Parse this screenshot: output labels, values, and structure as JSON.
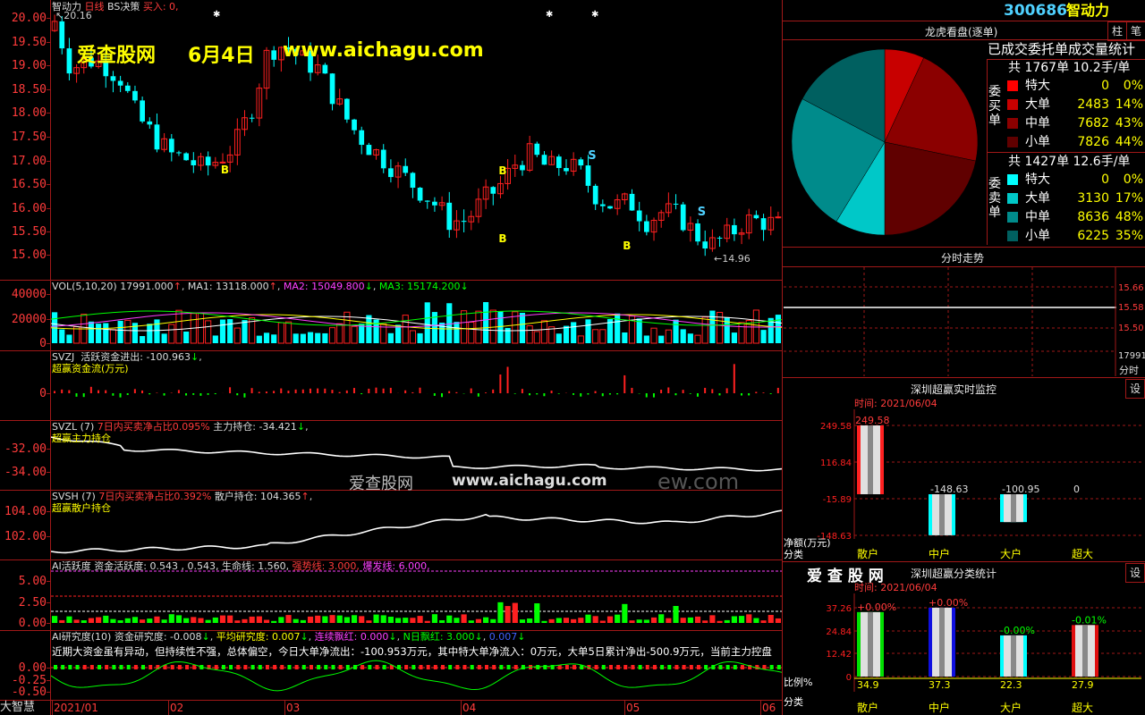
{
  "colors": {
    "up": "#ff2020",
    "down": "#00ffff",
    "frame": "#a01818",
    "yellow": "#ffff00",
    "magenta": "#ff40ff",
    "green": "#00ff00",
    "white": "#ffffff"
  },
  "main_chart": {
    "title": "智动力",
    "period": "日线",
    "strategy": "BS决策",
    "signal_label": "买入: 0,",
    "high_marker": "20.16",
    "low_marker": "14.96",
    "y_ticks": [
      "20.00",
      "19.50",
      "19.00",
      "18.50",
      "18.00",
      "17.50",
      "17.00",
      "16.50",
      "16.00",
      "15.50",
      "15.00"
    ],
    "buy_marks": [
      "B",
      "B",
      "B",
      "B"
    ],
    "sell_marks": [
      "S",
      "S"
    ]
  },
  "watermark": {
    "brand": "爱查股网",
    "date": "6月4日",
    "url": "www.aichagu.com",
    "overlay_brand": "爱查股网",
    "overlay_url": "www.aichagu.com",
    "overlay_tail": "ew.com"
  },
  "vol_panel": {
    "label": "VOL(5,10,20)",
    "vol": "17991.000",
    "ma1_label": "MA1:",
    "ma1": "13118.000",
    "ma2_label": "MA2:",
    "ma2": "15049.800",
    "ma3_label": "MA3:",
    "ma3": "15174.200",
    "y_ticks": [
      "40000",
      "20000",
      "0"
    ]
  },
  "svzj_panel": {
    "code": "SVZJ",
    "label": "活跃资金进出:",
    "value": "-100.963",
    "sub": "超赢资金流(万元)",
    "y_ticks": [
      "0"
    ]
  },
  "svzl_panel": {
    "code": "SVZL",
    "param": "(7)",
    "ratio_label": "7日内买卖净占比0.095%",
    "hold_label": "主力持仓:",
    "hold": "-34.421",
    "sub": "超赢主力持仓",
    "y_ticks": [
      "-32.00",
      "-34.00"
    ]
  },
  "svsh_panel": {
    "code": "SVSH",
    "param": "(7)",
    "ratio_label": "7日内买卖净占比0.392%",
    "hold_label": "散户持仓:",
    "hold": "104.365",
    "sub": "超赢散户持仓",
    "y_ticks": [
      "104.00",
      "102.00"
    ]
  },
  "ai_panel": {
    "label": "AI活跃度",
    "a": "资金活跃度: 0.543",
    "b": ", 0.543,",
    "c": "生命线: 1.560,",
    "d": "强势线: 3.000,",
    "e": "爆发线: 6.000,",
    "y_ticks": [
      "5.00",
      "2.50",
      "0.00"
    ]
  },
  "research_panel": {
    "label": "AI研究度(10)",
    "a": "资金研究度: -0.008",
    "b": "平均研究度: 0.007",
    "c": "连续飘红: 0.000",
    "d": "N日飘红: 3.000",
    "e": "0.007",
    "comment": "近期大资金虽有异动，但持续性不强，总体偏空，今日大单净流出：-100.953万元，其中特大单净流入：0万元，大单5日累计净出-500.9万元，当前主力控盘",
    "y_ticks": [
      "0.00",
      "-0.25",
      "-0.50"
    ]
  },
  "bottom_axis": {
    "logo": "大智慧",
    "dates": [
      "2021/01",
      "02",
      "03",
      "04",
      "05",
      "06"
    ]
  },
  "right_panel": {
    "header_code": "300686",
    "header_name": "智动力",
    "btn_zhu": "柱",
    "btn_zhu2": "笔",
    "dragon_title": "龙虎看盘(逐单)",
    "order_title": "已成交委托单成交量统计",
    "buy_label": "委买单",
    "buy_total": "共 1767单 10.2手/单",
    "buy_rows": [
      {
        "name": "特大",
        "count": "0",
        "pct": "0%",
        "color": "#ff0000"
      },
      {
        "name": "大单",
        "count": "2483",
        "pct": "14%",
        "color": "#c80000"
      },
      {
        "name": "中单",
        "count": "7682",
        "pct": "43%",
        "color": "#8b0000"
      },
      {
        "name": "小单",
        "count": "7826",
        "pct": "44%",
        "color": "#600000"
      }
    ],
    "sell_label": "委卖单",
    "sell_total": "共 1427单 12.6手/单",
    "sell_rows": [
      {
        "name": "特大",
        "count": "0",
        "pct": "0%",
        "color": "#00ffff"
      },
      {
        "name": "大单",
        "count": "3130",
        "pct": "17%",
        "color": "#00c8c8"
      },
      {
        "name": "中单",
        "count": "8636",
        "pct": "48%",
        "color": "#008b8b"
      },
      {
        "name": "小单",
        "count": "6225",
        "pct": "35%",
        "color": "#006060"
      }
    ],
    "timeshare_title": "分时走势",
    "ts_ticks": [
      "15.66",
      "15.58",
      "15.50",
      "17991"
    ],
    "ts_unit": "分时",
    "monitor_title": "深圳超赢实时监控",
    "monitor_gear": "设",
    "monitor_time": "时间: 2021/06/04",
    "monitor_ticks": [
      "249.58",
      "116.84",
      "-15.89",
      "-148.63"
    ],
    "monitor_ylabel": "净额(万元)",
    "monitor_xlabel": "分类",
    "monitor_values": [
      "249.58",
      "-148.63",
      "-100.95",
      "0"
    ],
    "monitor_cats": [
      "散户",
      "中户",
      "大户",
      "超大"
    ],
    "class_brand": "爱 查 股 网",
    "class_title": "深圳超赢分类统计",
    "class_gear": "设",
    "class_time": "时间: 2021/06/04",
    "class_ticks": [
      "37.26",
      "24.84",
      "12.42",
      "0"
    ],
    "class_ylabel": "比例%",
    "class_xlabel": "分类",
    "class_changes": [
      "+0.00%",
      "+0.00%",
      "-0.00%",
      "-0.01%"
    ],
    "class_values": [
      "34.9",
      "37.3",
      "22.3",
      "27.9"
    ],
    "class_cats": [
      "散户",
      "中户",
      "大户",
      "超大"
    ]
  },
  "chart_data": [
    {
      "type": "pie",
      "title": "龙虎看盘(逐单)",
      "labels": [
        "委买特大",
        "委买大单",
        "委买中单",
        "委买小单",
        "委卖特大",
        "委卖大单",
        "委卖中单",
        "委卖小单"
      ],
      "values": [
        0,
        2483,
        7682,
        7826,
        0,
        3130,
        8636,
        6225
      ]
    },
    {
      "type": "bar",
      "title": "深圳超赢实时监控",
      "categories": [
        "散户",
        "中户",
        "大户",
        "超大"
      ],
      "values": [
        249.58,
        -148.63,
        -100.95,
        0
      ],
      "ylabel": "净额(万元)",
      "ylim": [
        -148.63,
        249.58
      ]
    },
    {
      "type": "bar",
      "title": "深圳超赢分类统计",
      "categories": [
        "散户",
        "中户",
        "大户",
        "超大"
      ],
      "values": [
        34.9,
        37.3,
        22.3,
        27.9
      ],
      "ylabel": "比例%",
      "ylim": [
        0,
        37.26
      ]
    }
  ]
}
